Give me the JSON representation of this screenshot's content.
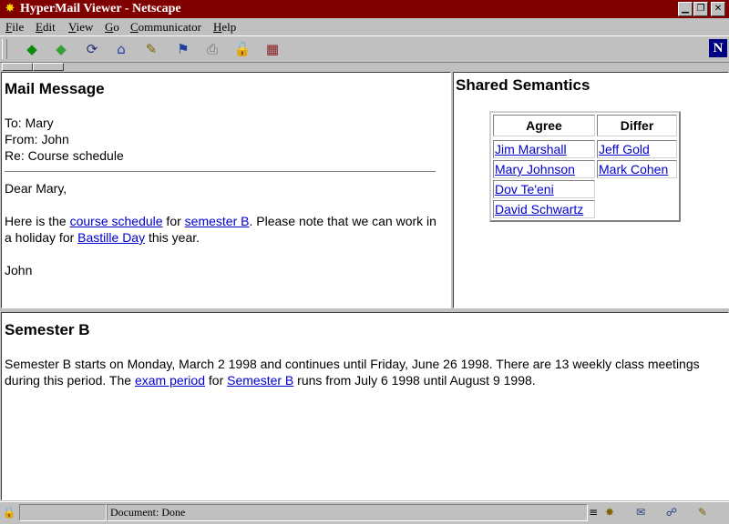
{
  "window": {
    "title": "HyperMail Viewer - Netscape"
  },
  "menu": [
    {
      "key": "F",
      "rest": "ile"
    },
    {
      "key": "E",
      "rest": "dit"
    },
    {
      "key": "V",
      "rest": "iew"
    },
    {
      "key": "G",
      "rest": "o"
    },
    {
      "key": "C",
      "rest": "ommunicator"
    },
    {
      "key": "H",
      "rest": "elp"
    }
  ],
  "toolbar": {
    "icons": [
      "back-icon",
      "forward-icon",
      "reload-icon",
      "home-icon",
      "search-icon",
      "guide-icon",
      "print-icon",
      "security-icon",
      "stop-icon"
    ],
    "logo": "N"
  },
  "mail": {
    "heading": "Mail Message",
    "to": "To: Mary",
    "from": "From: John",
    "re": "Re: Course schedule",
    "greeting": "Dear Mary,",
    "body_1": "Here is the ",
    "link_course": "course schedule",
    "body_2": " for ",
    "link_semester": "semester B",
    "body_3": ". Please note that we can work in a holiday for ",
    "link_bastille": "Bastille Day",
    "body_4": " this year.",
    "signature": "John"
  },
  "semantics": {
    "heading": "Shared Semantics",
    "agree_header": "Agree",
    "differ_header": "Differ",
    "agree": [
      "Jim Marshall",
      "Mary Johnson",
      "Dov Te'eni",
      "David Schwartz"
    ],
    "differ": [
      "Jeff Gold",
      "Mark Cohen"
    ]
  },
  "semester": {
    "heading": "Semester B",
    "text_1": "Semester B starts on Monday, March 2 1998 and continues until Friday, June 26 1998. There are 13 weekly class meetings during this period. The ",
    "link_exam": "exam period",
    "text_2": " for ",
    "link_semester": "Semester B",
    "text_3": " runs from July 6 1998 until August 9 1998."
  },
  "status": {
    "text": "Document: Done"
  }
}
